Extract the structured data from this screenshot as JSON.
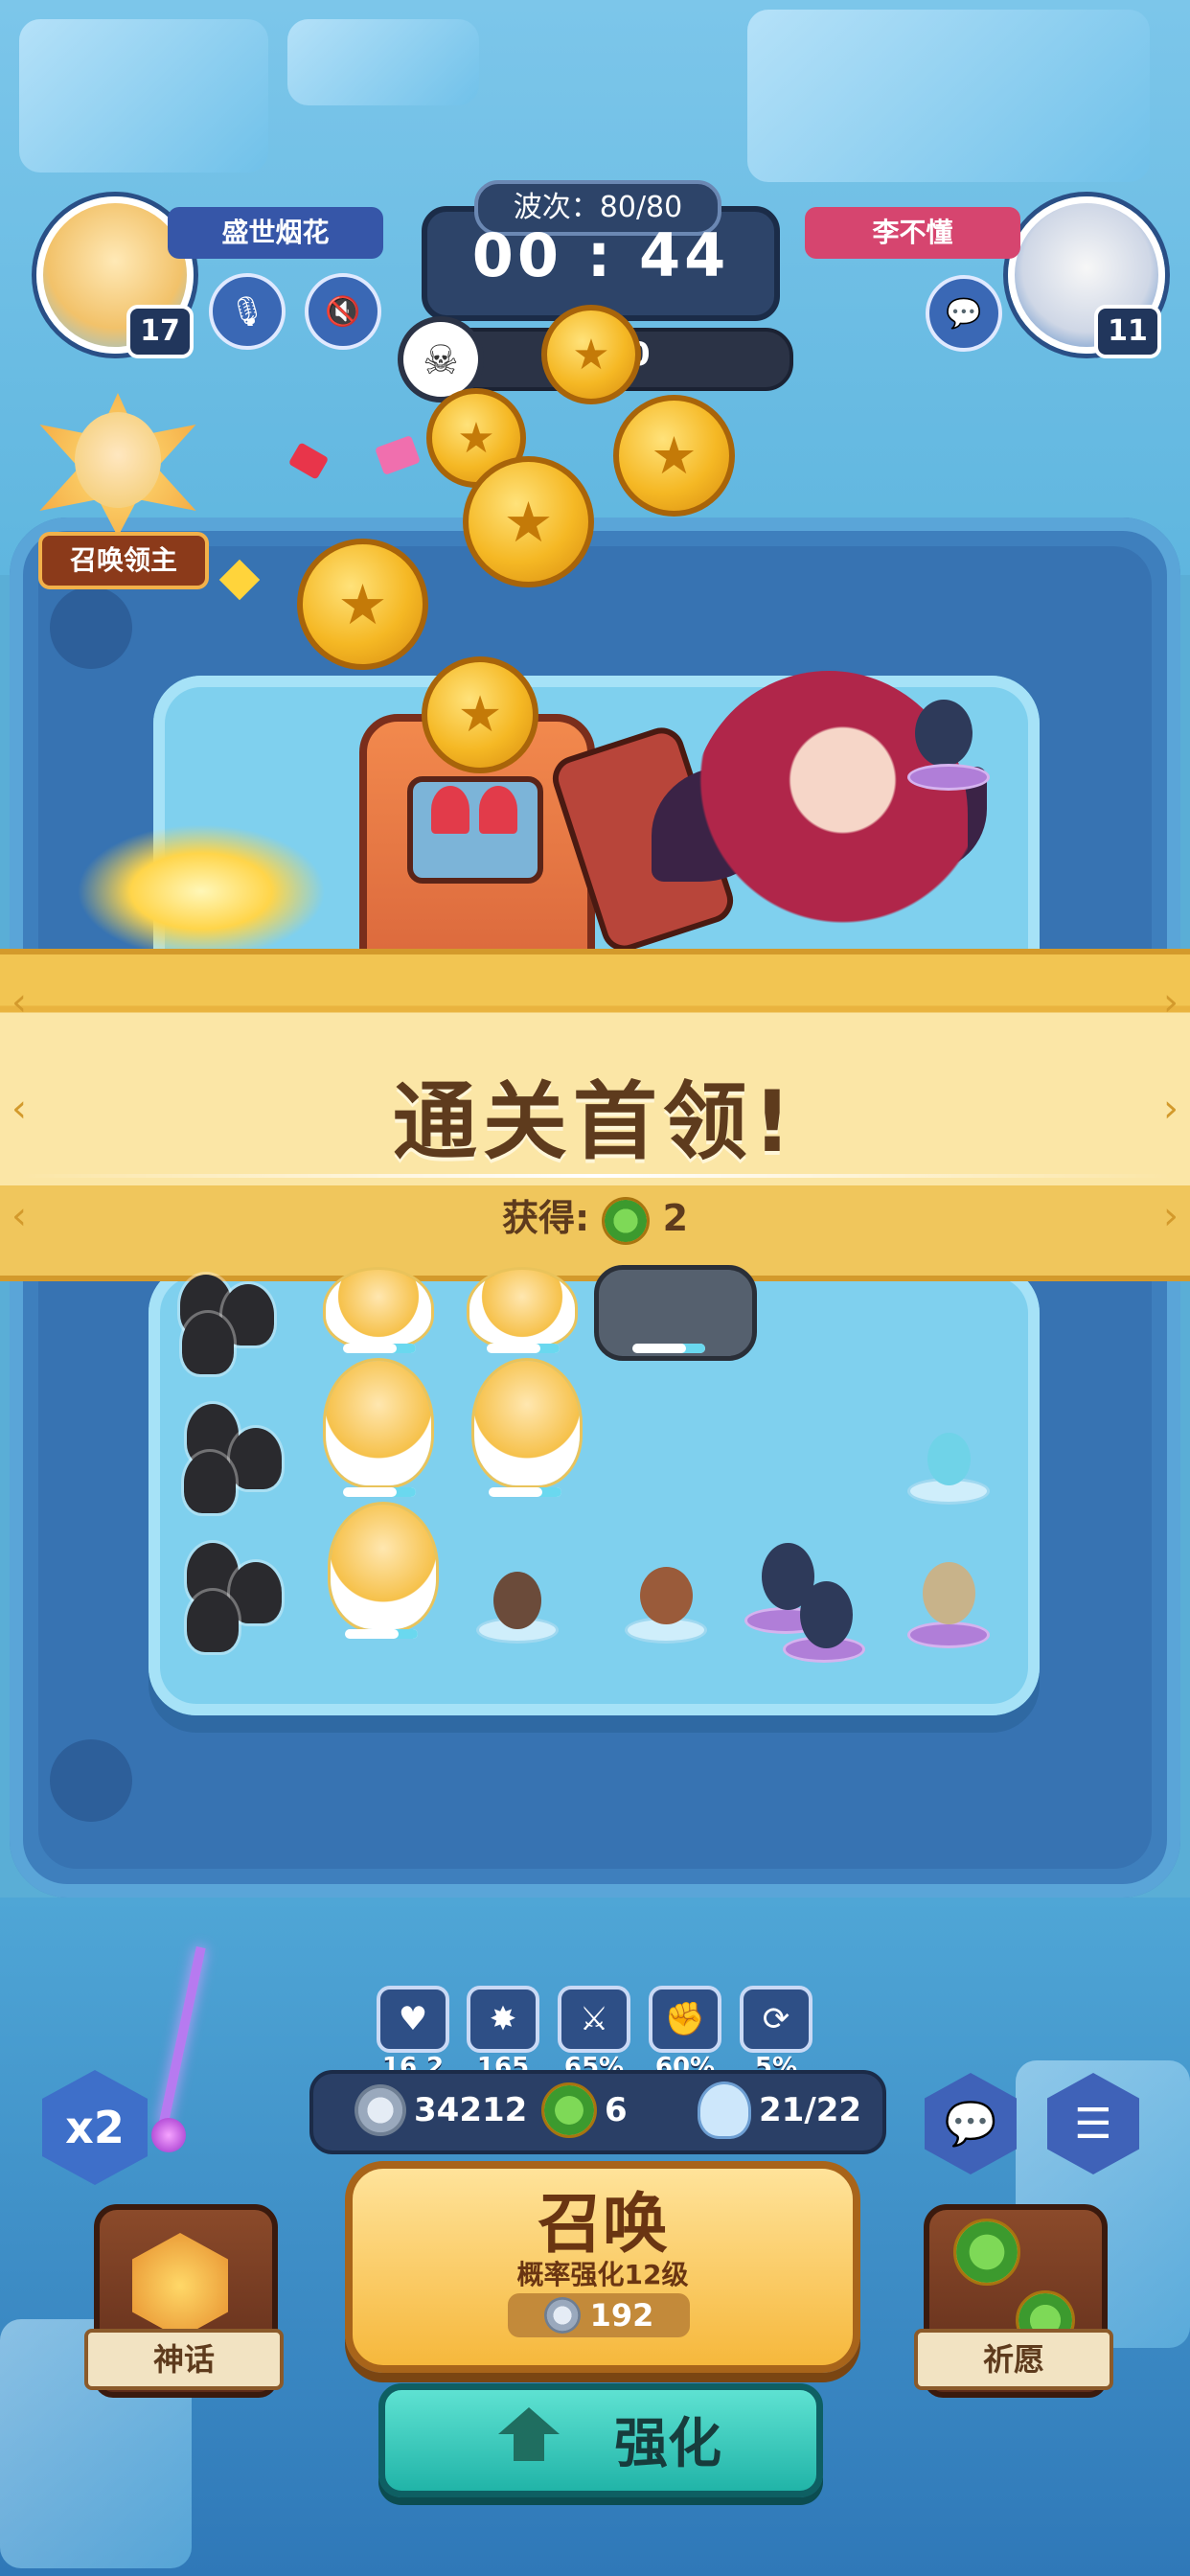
{
  "player_left": {
    "name": "盛世烟花",
    "level": "17"
  },
  "player_right": {
    "name": "李不懂",
    "level": "11"
  },
  "hud": {
    "wave_label": "波次：80/80",
    "timer": "00 : 44",
    "boss_count": "0"
  },
  "summon_lord": {
    "label": "召唤领主"
  },
  "banner": {
    "title": "通关首领!",
    "reward_label": "获得:",
    "reward_amount": "2"
  },
  "stats": [
    {
      "icon": "heart-icon",
      "value": "16.2"
    },
    {
      "icon": "crit-icon",
      "value": "165"
    },
    {
      "icon": "sword-up-icon",
      "value": "65%"
    },
    {
      "icon": "fist-up-icon",
      "value": "60%"
    },
    {
      "icon": "cooldown-up-icon",
      "value": "5%"
    }
  ],
  "resources": {
    "silver": "34212",
    "clover": "6",
    "units": "21/22"
  },
  "buttons": {
    "speed": "x2",
    "summon_title": "召唤",
    "summon_sub": "概率强化12级",
    "summon_cost": "192",
    "upgrade": "强化",
    "myth": "神话",
    "wish": "祈愿"
  },
  "colors": {
    "banner_gold": "#f2c552",
    "summon_orange": "#f6b83c",
    "upgrade_teal": "#21b4a8",
    "name_left": "#3656a8",
    "name_right": "#d6456f"
  }
}
